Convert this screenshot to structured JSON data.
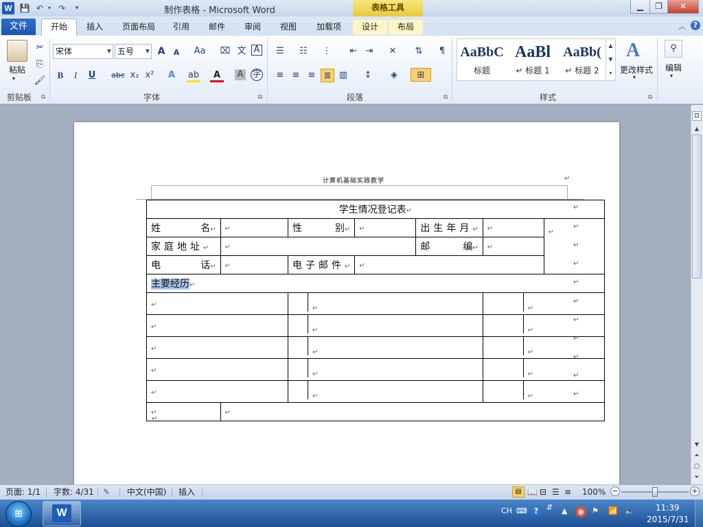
{
  "window": {
    "title": "制作表格 - Microsoft Word",
    "context_header": "表格工具",
    "app_icon_letter": "W"
  },
  "tabs": [
    "文件",
    "开始",
    "插入",
    "页面布局",
    "引用",
    "邮件",
    "审阅",
    "视图",
    "加载项",
    "设计",
    "布局"
  ],
  "ribbon": {
    "clipboard": {
      "paste": "粘贴",
      "label": "剪贴板"
    },
    "font": {
      "name": "宋体",
      "size": "五号",
      "label": "字体",
      "grow": "A",
      "shrink": "A",
      "case": "Aa",
      "bold": "B",
      "italic": "I",
      "underline": "U",
      "strike": "abc",
      "sub": "x₂",
      "sup": "x²",
      "color_a": "A",
      "border_a": "A"
    },
    "paragraph": {
      "label": "段落"
    },
    "styles": {
      "label": "样式",
      "items": [
        {
          "sample": "AaBbC",
          "name": "标题"
        },
        {
          "sample": "AaBl",
          "name": "↵ 标题 1"
        },
        {
          "sample": "AaBb(",
          "name": "↵ 标题 2"
        }
      ],
      "change": "更改样式"
    },
    "editing": {
      "label": "编辑"
    }
  },
  "document": {
    "header_text": "计算机基础实践教学",
    "table": {
      "title": "学生情况登记表",
      "name_label": "姓名",
      "gender_label": "性别",
      "birth_label": "出生年月",
      "address_label": "家庭地址",
      "zip_label": "邮编",
      "phone_label": "电话",
      "email_label": "电子邮件",
      "history_label": "主要经历"
    }
  },
  "statusbar": {
    "page": "页面: 1/1",
    "words": "字数: 4/31",
    "language": "中文(中国)",
    "mode": "插入",
    "zoom": "100%",
    "zoom_level": 0.5
  },
  "taskbar": {
    "ime": "CH",
    "time": "11:39",
    "date": "2015/7/31"
  }
}
